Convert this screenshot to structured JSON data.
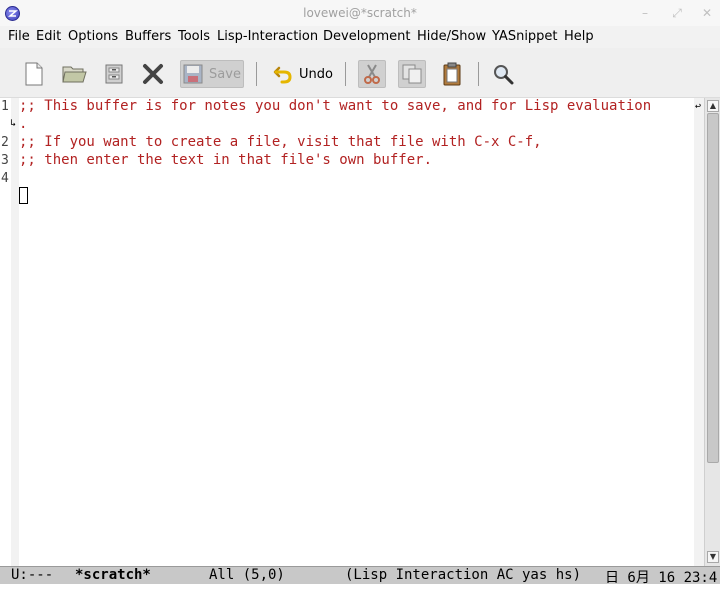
{
  "window": {
    "title": "lovewei@*scratch*",
    "controls": {
      "minimize": "–",
      "maximize": "⤢",
      "close": "✕"
    }
  },
  "menubar": {
    "items": [
      "File",
      "Edit",
      "Options",
      "Buffers",
      "Tools",
      "Lisp-Interaction",
      "Development",
      "Hide/Show",
      "YASnippet",
      "Help"
    ]
  },
  "toolbar": {
    "save_label": "Save",
    "undo_label": "Undo",
    "icons": [
      "new-file-icon",
      "open-folder-icon",
      "dired-icon",
      "close-icon",
      "save-icon",
      "undo-icon",
      "cut-icon",
      "copy-icon",
      "paste-icon",
      "search-icon"
    ]
  },
  "editor": {
    "line_numbers": [
      "1",
      "2",
      "3",
      "4"
    ],
    "lines": [
      ";; This buffer is for notes you don't want to save, and for Lisp evaluation",
      ".",
      ";; If you want to create a file, visit that file with C-x C-f,",
      ";; then enter the text in that file's own buffer."
    ],
    "text_color": "#b22222"
  },
  "modeline": {
    "status": "U:---",
    "buffer_name": "*scratch*",
    "position": "All (5,0)",
    "modes": "(Lisp Interaction AC yas hs)",
    "time": "日 6月 16 23:4"
  }
}
